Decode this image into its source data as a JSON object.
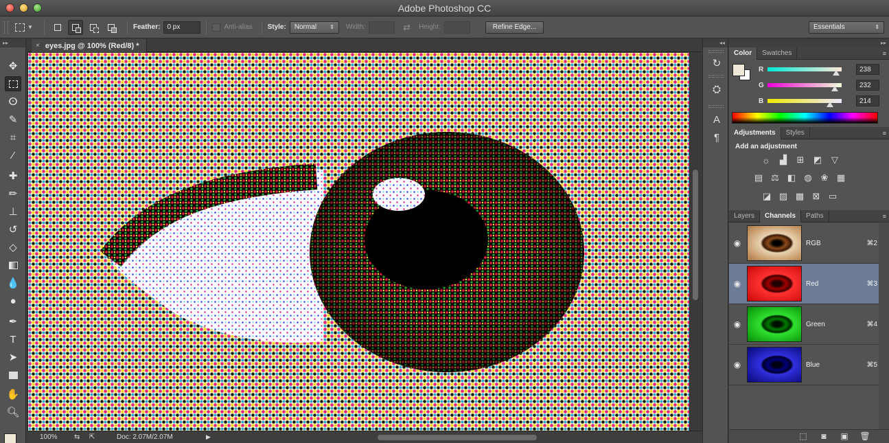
{
  "app": {
    "title": "Adobe Photoshop CC"
  },
  "options": {
    "feather_label": "Feather:",
    "feather_value": "0 px",
    "antialias_label": "Anti-alias",
    "style_label": "Style:",
    "style_value": "Normal",
    "width_label": "Width:",
    "height_label": "Height:",
    "refine_edge": "Refine Edge...",
    "workspace": "Essentials"
  },
  "document": {
    "tab_title": "eyes.jpg @ 100% (Red/8) *",
    "close_glyph": "×",
    "zoom": "100%",
    "doc_info": "Doc: 2.07M/2.07M"
  },
  "color_panel": {
    "tabs": [
      "Color",
      "Swatches"
    ],
    "r_label": "R",
    "g_label": "G",
    "b_label": "B",
    "r": "238",
    "g": "232",
    "b": "214",
    "foreground": "#eee8d6"
  },
  "adjustments_panel": {
    "tabs": [
      "Adjustments",
      "Styles"
    ],
    "heading": "Add an adjustment"
  },
  "channels_panel": {
    "tabs": [
      "Layers",
      "Channels",
      "Paths"
    ],
    "channels": [
      {
        "name": "RGB",
        "shortcut": "⌘2"
      },
      {
        "name": "Red",
        "shortcut": "⌘3"
      },
      {
        "name": "Green",
        "shortcut": "⌘4"
      },
      {
        "name": "Blue",
        "shortcut": "⌘5"
      }
    ],
    "selected": "Red"
  },
  "colors": {
    "accent_selected": "#6c7c96",
    "panel": "#535353"
  }
}
